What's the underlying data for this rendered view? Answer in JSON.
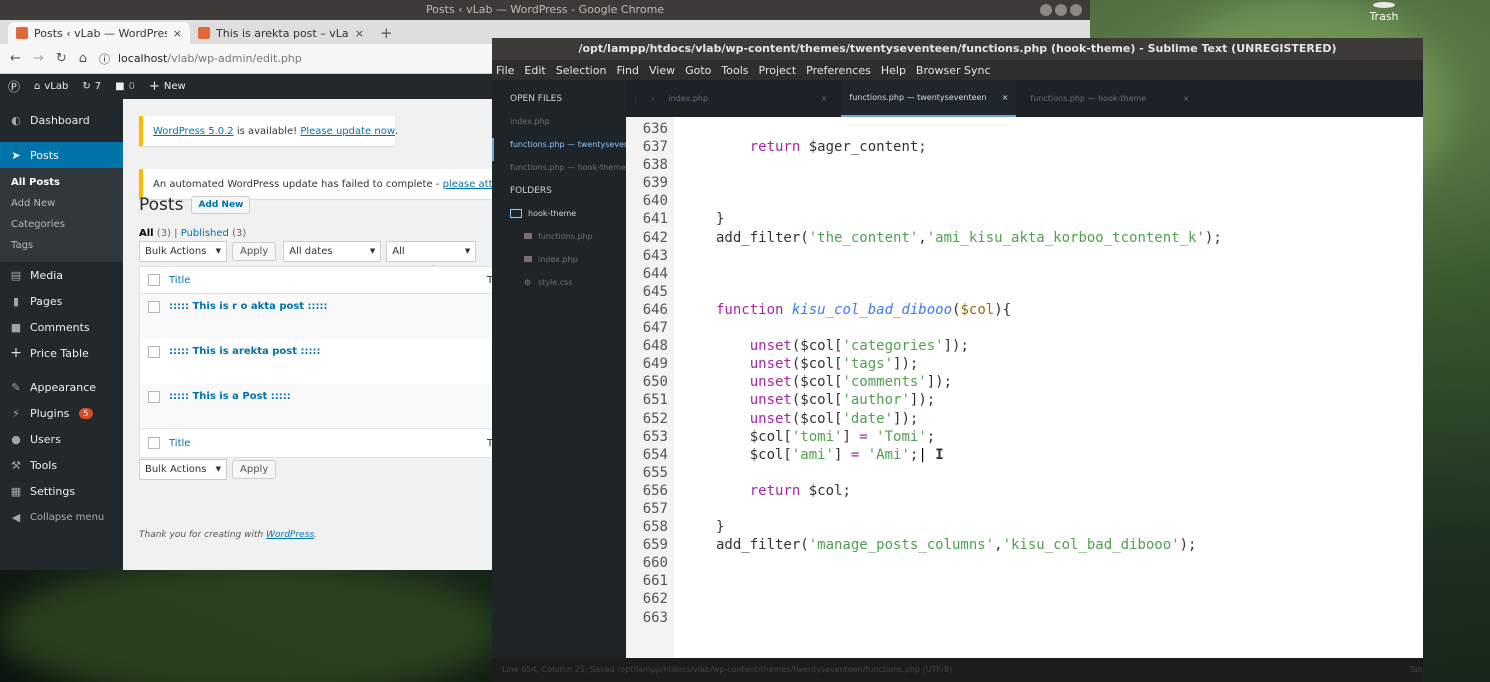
{
  "desktop": {
    "trash_label": "Trash"
  },
  "chrome": {
    "window_title": "Posts ‹ vLab — WordPress - Google Chrome",
    "tabs": [
      {
        "label": "Posts ‹ vLab — WordPres",
        "close": "×"
      },
      {
        "label": "This is arekta post – vLab",
        "close": "×"
      }
    ],
    "newtab": "+",
    "url_host": "localhost",
    "url_path": "/vlab/wp-admin/edit.php"
  },
  "adminbar": {
    "site": "vLab",
    "updates": "7",
    "comments": "0",
    "new": "New"
  },
  "sidebar": {
    "items": [
      {
        "label": "Dashboard",
        "icon": "dashboard-icon"
      },
      {
        "label": "Posts",
        "icon": "pin-icon"
      },
      {
        "label": "Media",
        "icon": "media-icon"
      },
      {
        "label": "Pages",
        "icon": "page-icon"
      },
      {
        "label": "Comments",
        "icon": "comment-icon"
      },
      {
        "label": "Price Table",
        "icon": "plus-icon"
      },
      {
        "label": "Appearance",
        "icon": "brush-icon"
      },
      {
        "label": "Plugins",
        "icon": "plug-icon",
        "badge": "5"
      },
      {
        "label": "Users",
        "icon": "user-icon"
      },
      {
        "label": "Tools",
        "icon": "wrench-icon"
      },
      {
        "label": "Settings",
        "icon": "settings-icon"
      },
      {
        "label": "Collapse menu",
        "icon": "collapse-icon"
      }
    ],
    "posts_sub": [
      "All Posts",
      "Add New",
      "Categories",
      "Tags"
    ]
  },
  "notices": {
    "update_text": "WordPress 5.0.2",
    "update_mid": " is available! ",
    "update_link": "Please update now",
    "update_end": ".",
    "failed_text": "An automated WordPress update has failed to complete - ",
    "failed_link": "please attem"
  },
  "posts": {
    "title": "Posts",
    "add_new": "Add New",
    "all": "All",
    "all_count": "(3)",
    "sep": "|",
    "published": "Published",
    "published_count": "(3)",
    "bulk_actions": "Bulk Actions",
    "apply": "Apply",
    "all_dates": "All dates",
    "all_categories": "All Categories",
    "col_title": "Title",
    "col_tomi": "Tom",
    "rows": [
      "::::: This is r o akta post :::::",
      "::::: This is arekta post :::::",
      "::::: This is a Post :::::"
    ],
    "footer_text": "Thank you for creating with ",
    "footer_link": "WordPress",
    "footer_end": "."
  },
  "sublime": {
    "title": "/opt/lampp/htdocs/vlab/wp-content/themes/twentyseventeen/functions.php (hook-theme) - Sublime Text (UNREGISTERED)",
    "menu": [
      "File",
      "Edit",
      "Selection",
      "Find",
      "View",
      "Goto",
      "Tools",
      "Project",
      "Preferences",
      "Help",
      "Browser Sync"
    ],
    "open_files_label": "OPEN FILES",
    "open_files": [
      "index.php",
      "functions.php — twentyseventeen",
      "functions.php — hook-theme"
    ],
    "folders_label": "FOLDERS",
    "folder": "hook-theme",
    "folder_files": [
      "functions.php",
      "index.php",
      "style.css"
    ],
    "tabs": [
      "index.php",
      "functions.php — twentyseventeen",
      "functions.php — hook-theme"
    ],
    "tab_close": "×",
    "status": "Line 654, Column 25; Saved /opt/lampp/htdocs/vlab/wp-content/themes/twentyseventeen/functions.php (UTF-8)",
    "status_right": "Tab",
    "line_numbers": [
      "636",
      "637",
      "638",
      "639",
      "640",
      "641",
      "642",
      "643",
      "644",
      "645",
      "646",
      "647",
      "648",
      "649",
      "650",
      "651",
      "652",
      "653",
      "654",
      "655",
      "656",
      "657",
      "658",
      "659",
      "660",
      "661",
      "662",
      "663"
    ]
  }
}
